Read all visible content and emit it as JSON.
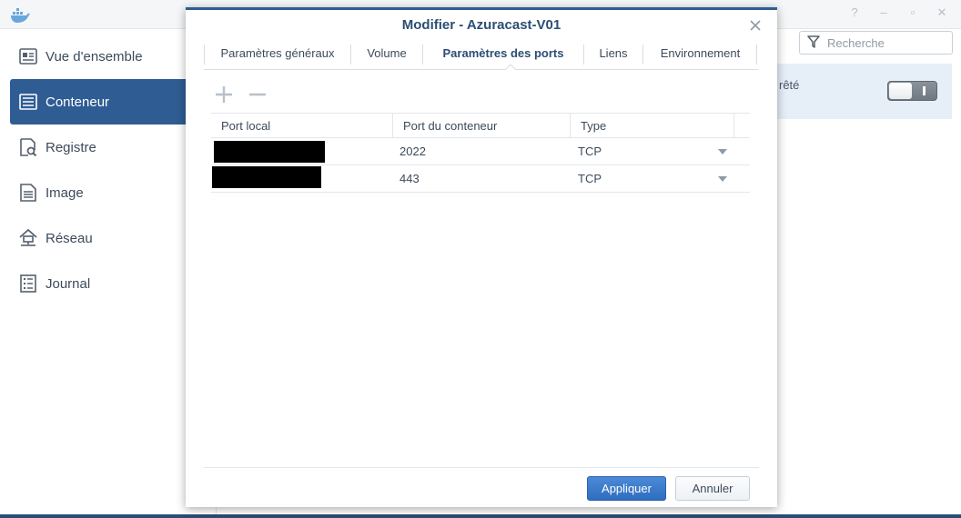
{
  "sidebar": {
    "items": [
      {
        "label": "Vue d'ensemble",
        "icon": "overview-icon"
      },
      {
        "label": "Conteneur",
        "icon": "container-icon",
        "active": true
      },
      {
        "label": "Registre",
        "icon": "registry-icon"
      },
      {
        "label": "Image",
        "icon": "image-icon"
      },
      {
        "label": "Réseau",
        "icon": "network-icon"
      },
      {
        "label": "Journal",
        "icon": "log-icon"
      }
    ]
  },
  "search": {
    "placeholder": "Recherche"
  },
  "background_row": {
    "text_fragment": "rêté",
    "toggle_state": "off"
  },
  "window_controls": [
    "help-icon",
    "minimize-icon",
    "maximize-icon",
    "close-icon"
  ],
  "modal": {
    "title": "Modifier - Azuracast-V01",
    "tabs": [
      {
        "label": "Paramètres généraux"
      },
      {
        "label": "Volume"
      },
      {
        "label": "Paramètres des ports",
        "active": true
      },
      {
        "label": "Liens"
      },
      {
        "label": "Environnement"
      }
    ],
    "toolbar": {
      "add_icon": "plus-icon",
      "remove_icon": "minus-icon"
    },
    "table": {
      "headers": [
        "Port local",
        "Port du conteneur",
        "Type"
      ],
      "rows": [
        {
          "local_port": "",
          "container_port": "2022",
          "type": "TCP"
        },
        {
          "local_port": "",
          "container_port": "443",
          "type": "TCP"
        }
      ]
    },
    "buttons": {
      "apply": "Appliquer",
      "cancel": "Annuler"
    }
  },
  "colors": {
    "accent": "#2f5d93",
    "primary_button": "#3a78c9",
    "selected_row_bg": "#e6eef8",
    "title_text": "#2b4d73"
  }
}
